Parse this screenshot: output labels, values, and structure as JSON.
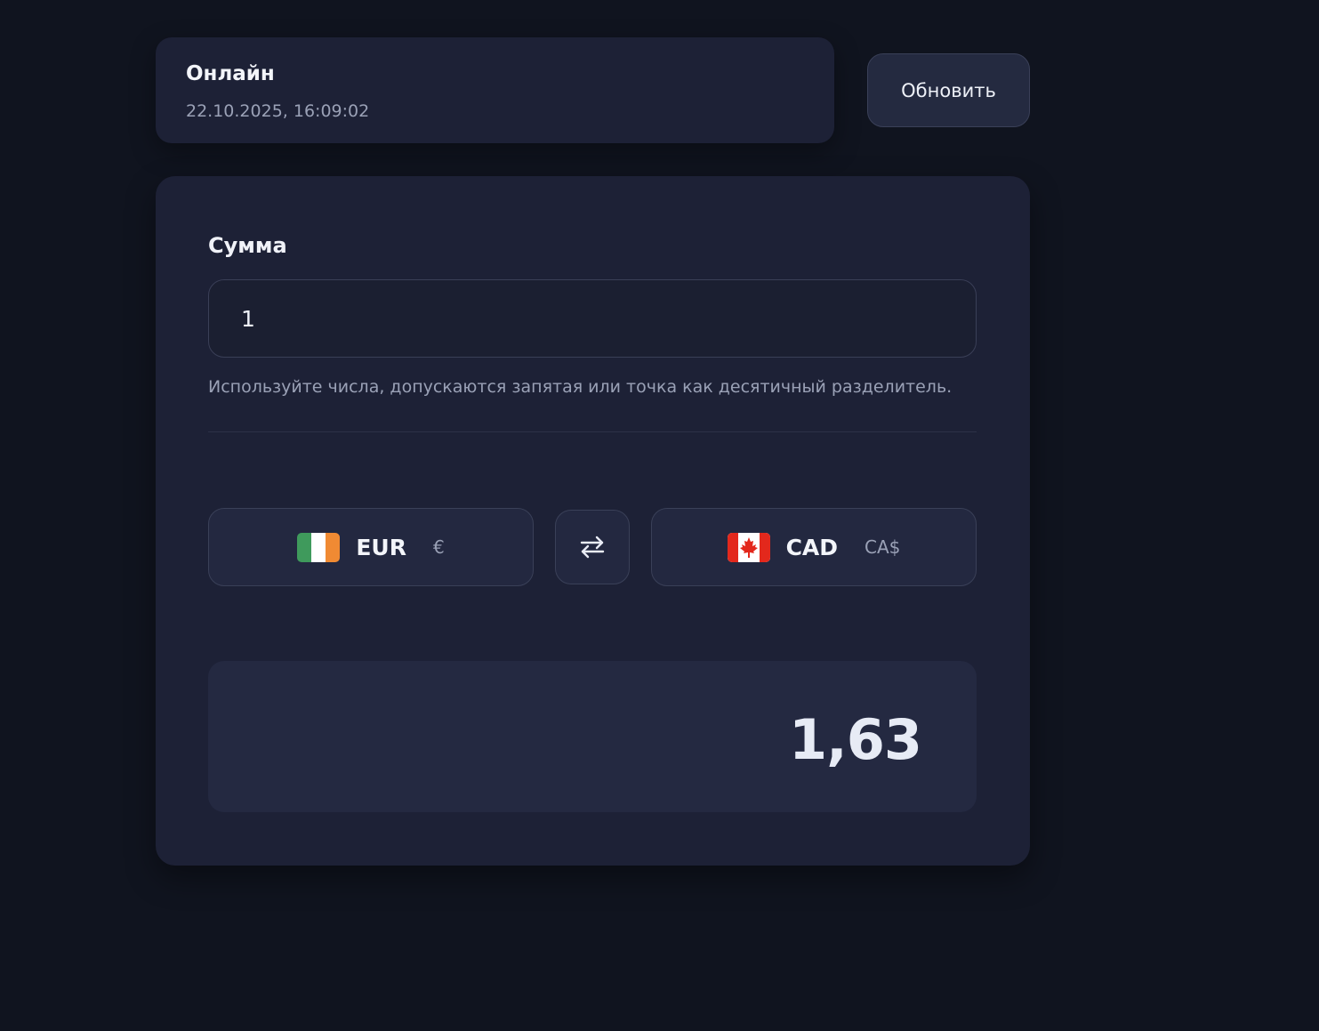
{
  "status": {
    "title": "Онлайн",
    "timestamp": "22.10.2025, 16:09:02"
  },
  "toolbar": {
    "refresh_label": "Обновить"
  },
  "converter": {
    "amount_label": "Сумма",
    "amount_value": "1",
    "hint": "Используйте числа, допускаются запятая или точка как десятичный разделитель.",
    "from": {
      "code": "EUR",
      "symbol": "€",
      "flag_icon": "ireland-flag-icon"
    },
    "to": {
      "code": "CAD",
      "symbol": "CA$",
      "flag_icon": "canada-flag-icon"
    },
    "swap_icon": "swap-arrows-icon",
    "result": "1,63"
  },
  "colors": {
    "background": "#10141f",
    "card": "#1d2136",
    "result_panel": "#242941",
    "muted_text": "#9aa1b6",
    "flag_ie_green": "#3f9a5c",
    "flag_ie_orange": "#f08a33",
    "flag_ca_red": "#e3281c"
  }
}
